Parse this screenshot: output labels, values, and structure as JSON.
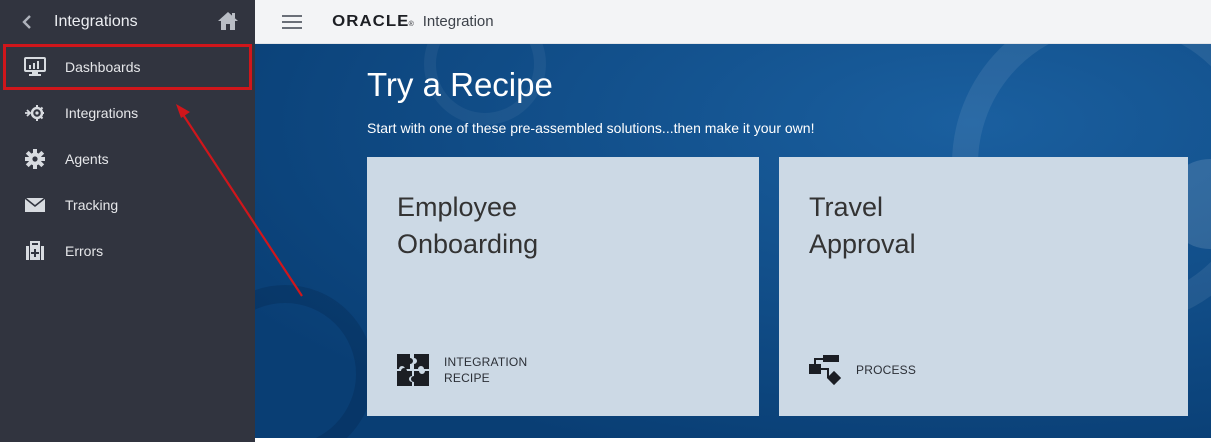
{
  "sidebar": {
    "title": "Integrations",
    "items": [
      {
        "label": "Dashboards",
        "icon": "monitor-chart-icon",
        "active": true
      },
      {
        "label": "Integrations",
        "icon": "integration-gear-icon"
      },
      {
        "label": "Agents",
        "icon": "gear-icon"
      },
      {
        "label": "Tracking",
        "icon": "envelope-icon"
      },
      {
        "label": "Errors",
        "icon": "first-aid-kit-icon"
      }
    ]
  },
  "topbar": {
    "brand": "ORACLE",
    "product": "Integration"
  },
  "hero": {
    "title": "Try a Recipe",
    "subtitle": "Start with one of these pre-assembled solutions...then make it your own!"
  },
  "cards": [
    {
      "title": "Employee\nOnboarding",
      "tag": "INTEGRATION\nRECIPE",
      "icon": "puzzle-icon"
    },
    {
      "title": "Travel\nApproval",
      "tag": "PROCESS",
      "icon": "process-flow-icon"
    }
  ],
  "colors": {
    "sidebar_bg": "#31343f",
    "hero_bg": "#0d4a86",
    "card_bg": "#ccd9e5",
    "annotation_red": "#d0161b"
  }
}
